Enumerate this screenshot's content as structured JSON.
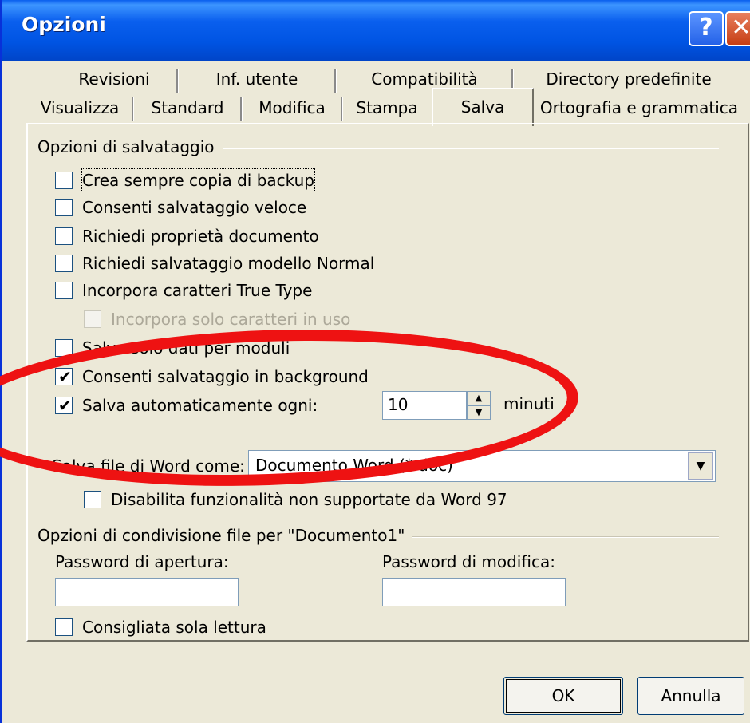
{
  "window": {
    "title": "Opzioni",
    "help_label": "?",
    "close_label": "✕"
  },
  "tabs": {
    "row1": [
      "Revisioni",
      "Inf. utente",
      "Compatibilità",
      "Directory predefinite"
    ],
    "row2": [
      "Visualizza",
      "Standard",
      "Modifica",
      "Stampa",
      "Salva",
      "Ortografia e grammatica"
    ],
    "active": "Salva"
  },
  "save_options": {
    "group_label": "Opzioni di salvataggio",
    "items": [
      {
        "label": "Crea sempre copia di backup",
        "checked": false,
        "disabled": false
      },
      {
        "label": "Consenti salvataggio veloce",
        "checked": false,
        "disabled": false
      },
      {
        "label": "Richiedi proprietà documento",
        "checked": false,
        "disabled": false
      },
      {
        "label": "Richiedi salvataggio modello Normal",
        "checked": false,
        "disabled": false
      },
      {
        "label": "Incorpora caratteri True Type",
        "checked": false,
        "disabled": false
      },
      {
        "label": "Incorpora solo caratteri in uso",
        "checked": false,
        "disabled": true
      },
      {
        "label": "Salva solo dati per moduli",
        "checked": false,
        "disabled": false
      },
      {
        "label": "Consenti salvataggio in background",
        "checked": true,
        "disabled": false
      },
      {
        "label": "Salva automaticamente ogni:",
        "checked": true,
        "disabled": false
      }
    ],
    "autosave_value": "10",
    "autosave_unit": "minuti",
    "save_as_label": "Salva file di Word come:",
    "save_as_value": "Documento Word (*.doc)",
    "disable_word97_label": "Disabilita funzionalità non supportate da Word 97"
  },
  "sharing": {
    "group_label": "Opzioni di condivisione file per \"Documento1\"",
    "open_password_label": "Password di apertura:",
    "open_password_value": "",
    "modify_password_label": "Password di modifica:",
    "modify_password_value": "",
    "readonly_label": "Consigliata sola lettura"
  },
  "buttons": {
    "ok": "OK",
    "cancel": "Annulla"
  },
  "colors": {
    "title_blue": "#0054E3",
    "dialog_bg": "#ECE9D8",
    "annotation_red": "#EE1212"
  }
}
